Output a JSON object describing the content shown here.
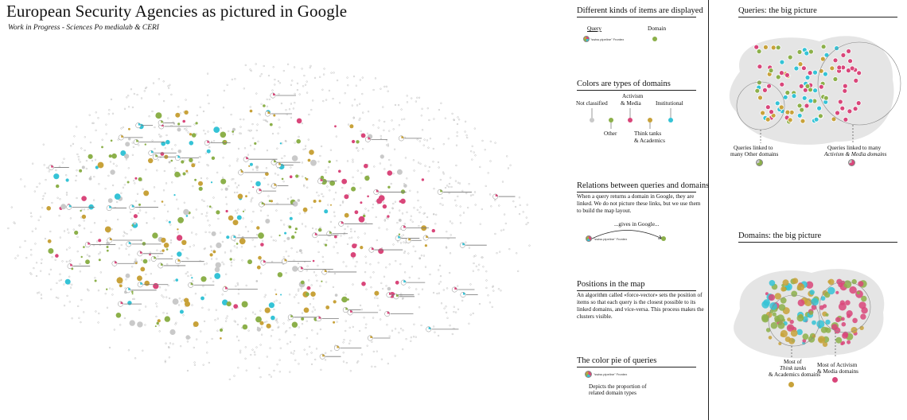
{
  "header": {
    "title": "European Security Agencies as pictured in Google",
    "subtitle": "Work in Progress - Sciences Po medialab & CERI"
  },
  "legend": {
    "items": {
      "title": "Different kinds of items are displayed",
      "query_label": "Query",
      "domain_label": "Domain",
      "query_example": "\"swiss pipeline\" Frontex"
    },
    "colors": {
      "title": "Colors are types of domains",
      "not_classified": "Not classified",
      "activism_line1": "Activism",
      "activism_line2": "& Media",
      "institutional": "Institutional",
      "other": "Other",
      "think_line1": "Think tanks",
      "think_line2": "& Academics"
    },
    "relations": {
      "title": "Relations between queries and domains",
      "text": "When a query returns a domain in Google, they are linked. We do not picture these links, but we use them to build the map layout.",
      "gives": "...gives in Google...",
      "query_example": "\"swiss pipeline\" Frontex"
    },
    "positions": {
      "title": "Positions in the map",
      "text": "An algorithm called «force-vector» sets the position of items so that each query is the closest possible to its linked domains, and vice-versa. This process makes the clusters visible."
    },
    "pie": {
      "title": "The color pie of queries",
      "query_example": "\"swiss pipeline\" Frontex",
      "text_line1": "Depicts the proportion of",
      "text_line2": "related domain types"
    }
  },
  "queries_panel": {
    "title": "Queries: the big picture",
    "left_line1": "Queries linked to",
    "left_line2": "many Other domains",
    "right_line1": "Queries linked to many",
    "right_line2": "Activism & Media domains"
  },
  "domains_panel": {
    "title": "Domains: the big picture",
    "left_line1": "Most of",
    "left_line2": "Think tanks",
    "left_line3": "& Academics domains",
    "right_line1": "Most of Activism",
    "right_line2": "& Media domains"
  },
  "colors": {
    "not_classified": "#c9c9c9",
    "other": "#8cb04a",
    "activism": "#d9467a",
    "think": "#c8a23a",
    "institutional": "#35c3d6"
  }
}
